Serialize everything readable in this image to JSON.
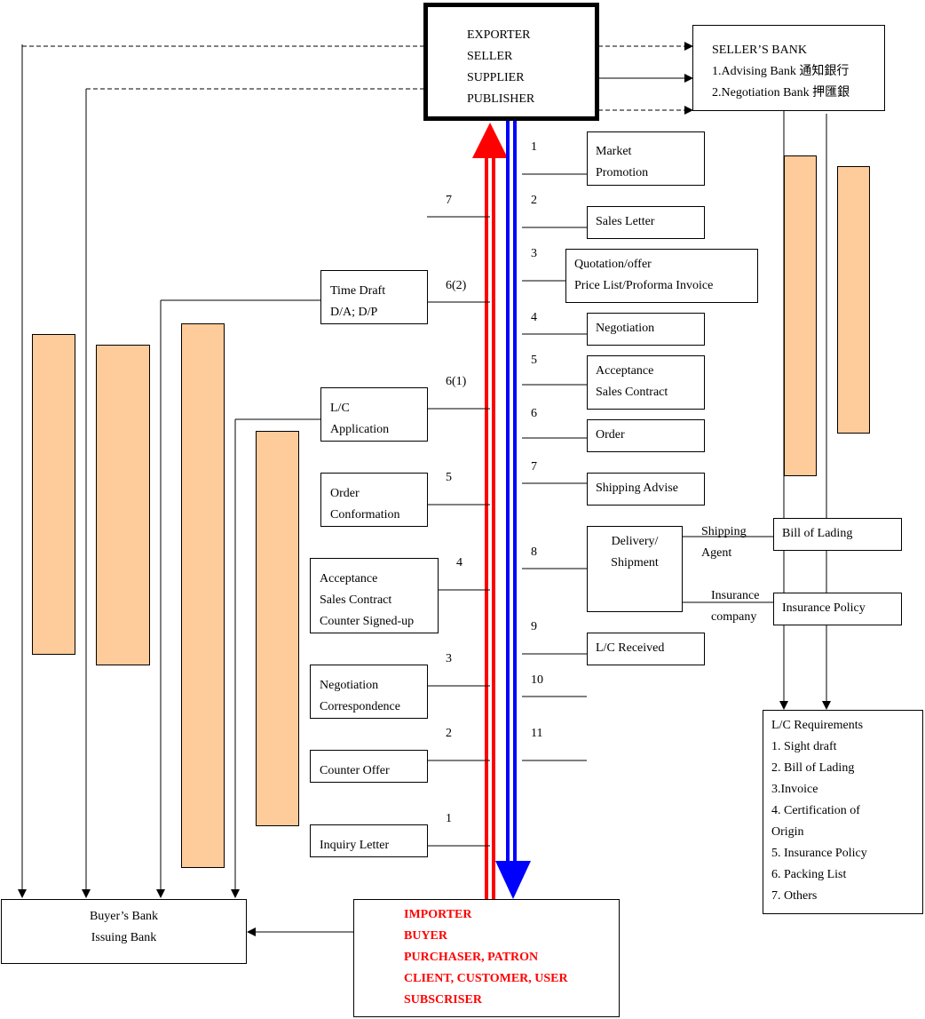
{
  "exporter": {
    "lines": [
      "EXPORTER",
      "SELLER",
      "SUPPLIER",
      "PUBLISHER"
    ]
  },
  "sellers_bank": {
    "lines": [
      "SELLER’S BANK",
      "1.Advising Bank 通知銀行",
      "2.Negotiation Bank 押匯銀"
    ]
  },
  "importer": {
    "lines": [
      "IMPORTER",
      "BUYER",
      "PURCHASER, PATRON",
      "CLIENT, CUSTOMER, USER",
      "SUBSCRISER"
    ],
    "text_color": "#ff0000"
  },
  "buyers_bank": {
    "lines": [
      "Buyer’s Bank",
      "Issuing Bank"
    ]
  },
  "seller_steps": [
    {
      "num": "1",
      "lines": [
        "Market",
        "Promotion"
      ]
    },
    {
      "num": "2",
      "lines": [
        "Sales Letter"
      ]
    },
    {
      "num": "3",
      "lines": [
        "Quotation/offer",
        "Price List/Proforma Invoice"
      ]
    },
    {
      "num": "4",
      "lines": [
        "Negotiation"
      ]
    },
    {
      "num": "5",
      "lines": [
        "Acceptance",
        "Sales Contract"
      ]
    },
    {
      "num": "6",
      "lines": [
        "Order"
      ]
    },
    {
      "num": "7",
      "lines": [
        "Shipping Advise"
      ]
    },
    {
      "num": "8",
      "lines": [
        "Delivery/",
        "Shipment"
      ]
    },
    {
      "num": "9",
      "lines": [
        "L/C Received"
      ]
    },
    {
      "num": "10",
      "lines": []
    },
    {
      "num": "11",
      "lines": []
    }
  ],
  "buyer_steps": [
    {
      "num": "7",
      "lines": []
    },
    {
      "num": "6(2)",
      "lines": [
        "Time Draft",
        "D/A; D/P"
      ]
    },
    {
      "num": "6(1)",
      "lines": [
        "L/C",
        "Application"
      ]
    },
    {
      "num": "5",
      "lines": [
        "Order",
        "Conformation"
      ]
    },
    {
      "num": "4",
      "lines": [
        "Acceptance",
        "Sales Contract",
        "Counter Signed-up"
      ]
    },
    {
      "num": "3",
      "lines": [
        "Negotiation",
        "Correspondence"
      ]
    },
    {
      "num": "2",
      "lines": [
        "Counter Offer"
      ]
    },
    {
      "num": "1",
      "lines": [
        "Inquiry Letter"
      ]
    }
  ],
  "shipping": {
    "agent_label": [
      "Shipping",
      "Agent"
    ],
    "insurance_label": [
      "Insurance",
      "company"
    ],
    "bill_of_lading": "Bill of Lading",
    "insurance_policy": "Insurance Policy"
  },
  "lc_requirements": {
    "lines": [
      "L/C Requirements",
      "1. Sight draft",
      "2. Bill of Lading",
      "3.Invoice",
      "4. Certification of",
      "Origin",
      "5. Insurance Policy",
      "6. Packing List",
      "7. Others"
    ]
  },
  "colors": {
    "upflow_arrow": "#ff0000",
    "downflow_arrow": "#0000ff",
    "bar_fill": "#fecb9a"
  }
}
